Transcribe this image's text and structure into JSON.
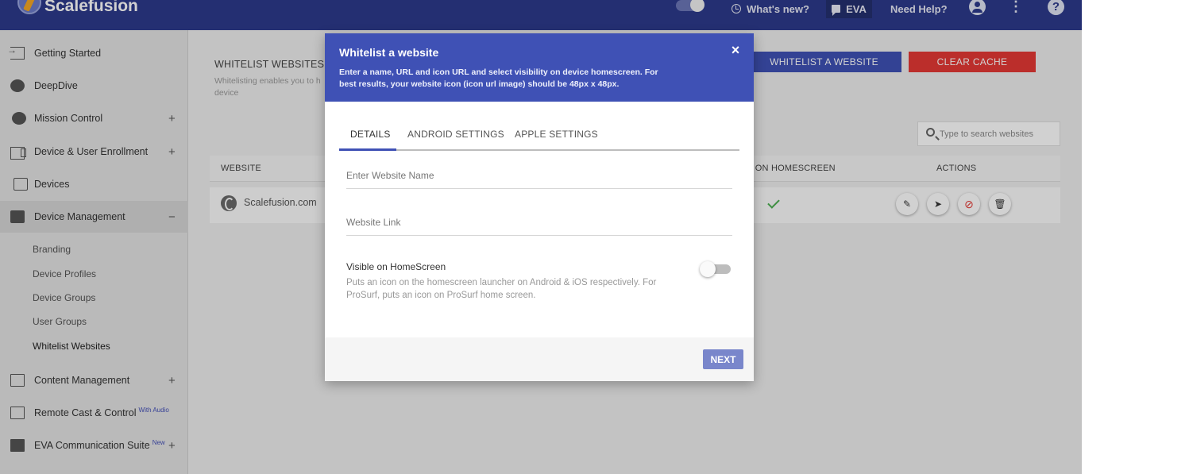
{
  "header": {
    "brand": "Scalefusion",
    "whats_new": "What's new?",
    "eva": "EVA",
    "need_help": "Need Help?",
    "help_glyph": "?",
    "kebab_glyph": "⋮",
    "color": "#2d3a8c"
  },
  "sidebar": {
    "items": [
      {
        "label": "Getting Started",
        "icon": "login-icon"
      },
      {
        "label": "DeepDive",
        "icon": "gauge-icon"
      },
      {
        "label": "Mission Control",
        "icon": "mission-icon",
        "expand": "+"
      },
      {
        "label": "Device & User Enrollment",
        "icon": "enroll-icon",
        "expand": "+"
      },
      {
        "label": "Devices",
        "icon": "phone-icon"
      },
      {
        "label": "Device Management",
        "icon": "briefcase-icon",
        "expand": "−"
      },
      {
        "label": "Content Management",
        "icon": "folder-icon",
        "expand": "+"
      },
      {
        "label": "Remote Cast & Control",
        "icon": "cast-icon",
        "badge": "With Audio"
      },
      {
        "label": "EVA Communication Suite",
        "icon": "chat-icon",
        "badge": "New",
        "expand": "+"
      }
    ],
    "sub_items": [
      "Branding",
      "Device Profiles",
      "Device Groups",
      "User Groups",
      "Whitelist Websites"
    ]
  },
  "main": {
    "title": "WHITELIST WEBSITES",
    "subtitle": "Whitelisting enables you to h device",
    "whitelist_button": "WHITELIST A WEBSITE",
    "clear_cache_button": "CLEAR CACHE",
    "search_placeholder": "Type to search websites",
    "columns": {
      "website": "WEBSITE",
      "homescreen": "E ON HOMESCREEN",
      "actions": "ACTIONS"
    },
    "rows": [
      {
        "name": "Scalefusion.com"
      }
    ],
    "action_glyphs": {
      "edit": "✎",
      "send": "➤",
      "block": "⊘",
      "delete": "🗑"
    }
  },
  "modal": {
    "title": "Whitelist a website",
    "description": "Enter a name, URL and icon URL and select visibility on device homescreen. For best results, your website icon (icon url image) should be 48px x 48px.",
    "close_glyph": "×",
    "tabs": [
      "DETAILS",
      "ANDROID SETTINGS",
      "APPLE SETTINGS"
    ],
    "website_name_placeholder": "Enter Website Name",
    "website_link_placeholder": "Website Link",
    "visible_label": "Visible on HomeScreen",
    "visible_desc": "Puts an icon on the homescreen launcher on Android & iOS respectively. For ProSurf, puts an icon on ProSurf home screen.",
    "visible_on": false,
    "next_button": "NEXT",
    "accent": "#3f51b5"
  }
}
